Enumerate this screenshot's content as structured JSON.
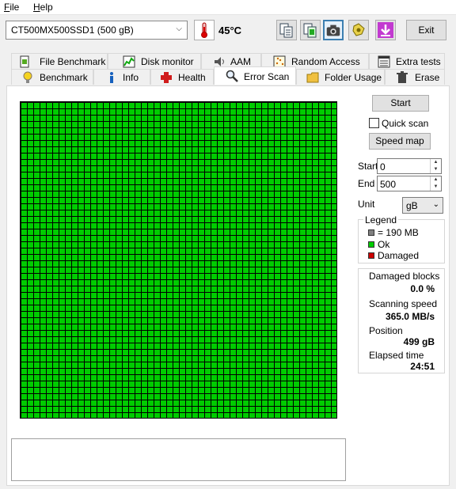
{
  "menu": {
    "file": "File",
    "help": "Help"
  },
  "toolbar": {
    "drive": "CT500MX500SSD1 (500 gB)",
    "temperature": "45°C",
    "exit_label": "Exit"
  },
  "tabs_top": [
    {
      "label": "File Benchmark",
      "icon": "file-benchmark-icon"
    },
    {
      "label": "Disk monitor",
      "icon": "disk-monitor-icon"
    },
    {
      "label": "AAM",
      "icon": "speaker-icon"
    },
    {
      "label": "Random Access",
      "icon": "random-access-icon"
    },
    {
      "label": "Extra tests",
      "icon": "extra-tests-icon"
    }
  ],
  "tabs_bottom": [
    {
      "label": "Benchmark",
      "icon": "lightbulb-icon"
    },
    {
      "label": "Info",
      "icon": "info-icon"
    },
    {
      "label": "Health",
      "icon": "health-cross-icon"
    },
    {
      "label": "Error Scan",
      "icon": "magnifier-icon",
      "active": true
    },
    {
      "label": "Folder Usage",
      "icon": "folder-icon"
    },
    {
      "label": "Erase",
      "icon": "trash-icon"
    }
  ],
  "controls": {
    "start_button": "Start",
    "quick_scan_label": "Quick scan",
    "quick_scan_checked": false,
    "speed_map_button": "Speed map",
    "start_label": "Start",
    "start_value": "0",
    "end_label": "End",
    "end_value": "500",
    "unit_label": "Unit",
    "unit_value": "gB"
  },
  "legend": {
    "title": "Legend",
    "items": [
      {
        "label": "= 190 MB",
        "color": "#808080"
      },
      {
        "label": "Ok",
        "color": "#00cc00"
      },
      {
        "label": "Damaged",
        "color": "#cc0000"
      }
    ]
  },
  "stats": {
    "damaged_blocks_label": "Damaged blocks",
    "damaged_blocks_value": "0.0 %",
    "scanning_speed_label": "Scanning speed",
    "scanning_speed_value": "365.0 MB/s",
    "position_label": "Position",
    "position_value": "499 gB",
    "elapsed_label": "Elapsed time",
    "elapsed_value": "24:51"
  },
  "scan_grid": {
    "status": "Ok",
    "ok_color": "#00cc00"
  },
  "log_text": ""
}
